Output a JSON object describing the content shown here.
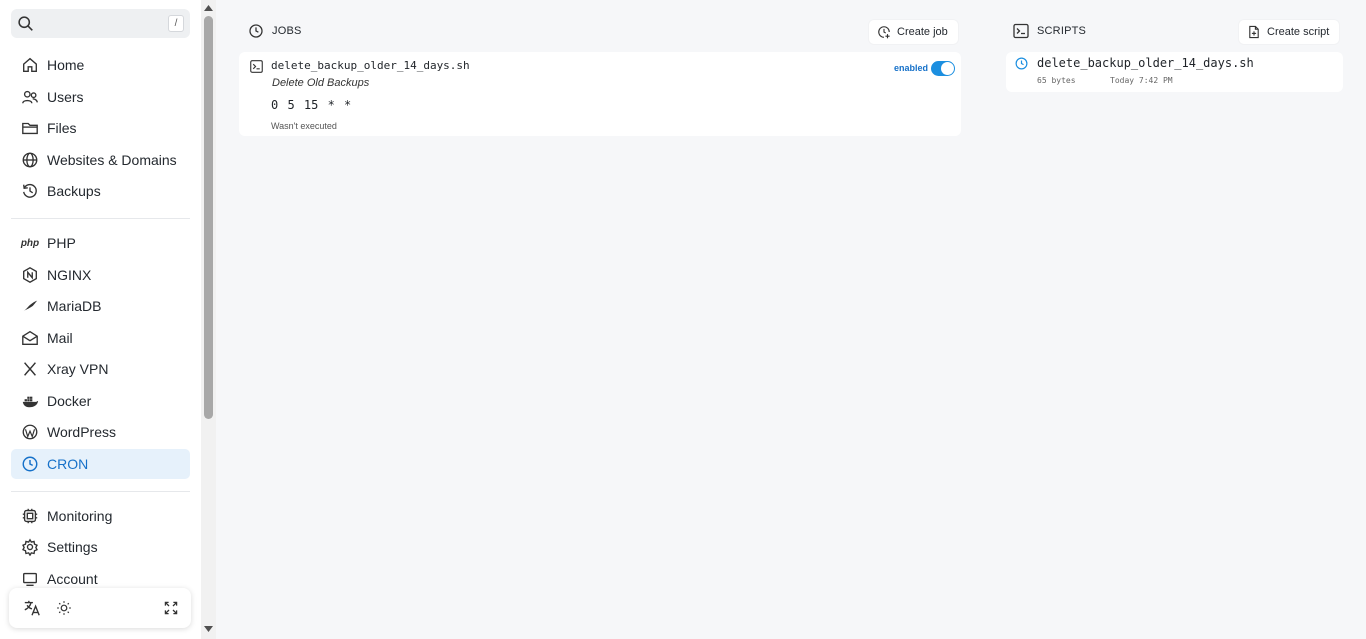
{
  "search": {
    "shortcut": "/"
  },
  "nav": {
    "primary": [
      {
        "label": "Home",
        "icon": "home-icon"
      },
      {
        "label": "Users",
        "icon": "users-icon"
      },
      {
        "label": "Files",
        "icon": "folder-icon"
      },
      {
        "label": "Websites & Domains",
        "icon": "globe-icon"
      },
      {
        "label": "Backups",
        "icon": "history-icon"
      }
    ],
    "apps": [
      {
        "label": "PHP",
        "icon": "php-icon",
        "icon_text": "php"
      },
      {
        "label": "NGINX",
        "icon": "nginx-icon"
      },
      {
        "label": "MariaDB",
        "icon": "mariadb-icon"
      },
      {
        "label": "Mail",
        "icon": "mail-icon"
      },
      {
        "label": "Xray VPN",
        "icon": "xray-icon"
      },
      {
        "label": "Docker",
        "icon": "docker-icon"
      },
      {
        "label": "WordPress",
        "icon": "wordpress-icon"
      },
      {
        "label": "CRON",
        "icon": "clock-icon",
        "active": true
      }
    ],
    "system": [
      {
        "label": "Monitoring",
        "icon": "monitor-icon"
      },
      {
        "label": "Settings",
        "icon": "gear-icon"
      },
      {
        "label": "Account",
        "icon": "account-icon"
      }
    ]
  },
  "bottom_bar": {
    "icons": [
      "translate-icon",
      "sun-icon",
      "fullscreen-icon"
    ]
  },
  "jobs": {
    "title": "JOBS",
    "create_label": "Create job",
    "items": [
      {
        "file": "delete_backup_older_14_days.sh",
        "description": "Delete Old Backups",
        "schedule": "0 5 15 * *",
        "status": "Wasn't executed",
        "enabled_label": "enabled",
        "enabled": true
      }
    ]
  },
  "scripts": {
    "title": "SCRIPTS",
    "create_label": "Create script",
    "items": [
      {
        "file": "delete_backup_older_14_days.sh",
        "size": "65 bytes",
        "modified": "Today 7:42 PM"
      }
    ]
  },
  "colors": {
    "accent": "#1671c9",
    "active_bg": "#e6f1fb",
    "toggle": "#1c8fe0",
    "background": "#f6f7f9"
  }
}
